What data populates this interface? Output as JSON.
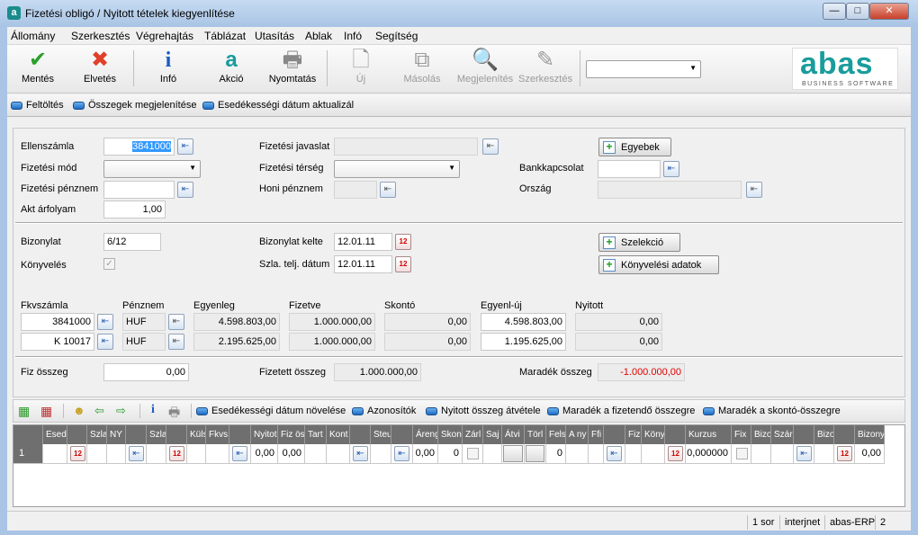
{
  "window": {
    "title": "Fizetési obligó / Nyitott tételek kiegyenlítése",
    "minimize": "—",
    "maximize": "□",
    "close": "✕"
  },
  "menu": [
    "Állomány",
    "Szerkesztés",
    "Végrehajtás",
    "Táblázat",
    "Utasítás",
    "Ablak",
    "Infó",
    "Segítség"
  ],
  "toolbar": {
    "save": "Mentés",
    "discard": "Elvetés",
    "info": "Infó",
    "action": "Akció",
    "print": "Nyomtatás",
    "new": "Új",
    "copy": "Másolás",
    "view": "Megjelenítés",
    "edit": "Szerkesztés",
    "combo_value": ""
  },
  "logo": {
    "text": "abas",
    "sub": "BUSINESS SOFTWARE",
    "color": "#1a9c9c"
  },
  "actions": [
    "Feltöltés",
    "Összegek megjelenítése",
    "Esedékességi dátum aktualizál"
  ],
  "form": {
    "ellenszamla_label": "Ellenszámla",
    "ellenszamla": "3841000",
    "fizmod_label": "Fizetési mód",
    "fizmod": "",
    "fizpenznem_label": "Fizetési pénznem",
    "fizpenznem": "",
    "arfolyam_label": "Akt árfolyam",
    "arfolyam": "1,00",
    "javaslat_label": "Fizetési javaslat",
    "javaslat": "",
    "terseg_label": "Fizetési térség",
    "terseg": "",
    "honi_label": "Honi pénznem",
    "honi": "",
    "egyebek": "Egyebek",
    "bank_label": "Bankkapcsolat",
    "bank": "",
    "orszag_label": "Ország",
    "orszag": "",
    "bizonylat_label": "Bizonylat",
    "bizonylat": "6/12",
    "konyveles_label": "Könyvelés",
    "konyveles_checked": true,
    "kelte_label": "Bizonylat kelte",
    "kelte": "12.01.11",
    "telj_label": "Szla. telj. dátum",
    "telj": "12.01.11",
    "szelekcio": "Szelekció",
    "konyv_adatok": "Könyvelési adatok",
    "acc_headers": [
      "Fkvszámla",
      "Pénznem",
      "Egyenleg",
      "Fizetve",
      "Skontó",
      "Egyenl-új",
      "Nyitott"
    ],
    "acc_rows": [
      [
        "3841000",
        "HUF",
        "4.598.803,00",
        "1.000.000,00",
        "0,00",
        "4.598.803,00",
        "0,00"
      ],
      [
        "K 10017",
        "HUF",
        "2.195.625,00",
        "1.000.000,00",
        "0,00",
        "1.195.625,00",
        "0,00"
      ]
    ],
    "fizosszeg_label": "Fiz összeg",
    "fizosszeg": "0,00",
    "fizetett_label": "Fizetett összeg",
    "fizetett": "1.000.000,00",
    "maradek_label": "Maradék összeg",
    "maradek": "-1.000.000,00",
    "maradek_color": "#e00000"
  },
  "grid_actions": [
    "Esedékességi dátum növelése",
    "Azonosítók",
    "Nyitott összeg átvétele",
    "Maradék a fizetendő összegre",
    "Maradék a skontó-összegre"
  ],
  "grid": {
    "columns": [
      {
        "h": "",
        "v": "1",
        "t": "rowhead"
      },
      {
        "h": "Esed",
        "v": ""
      },
      {
        "h": "",
        "t": "cal"
      },
      {
        "h": "Szla",
        "v": ""
      },
      {
        "h": "NY",
        "v": ""
      },
      {
        "h": "",
        "t": "lk"
      },
      {
        "h": "Szla",
        "v": ""
      },
      {
        "h": "",
        "t": "cal"
      },
      {
        "h": "Küls",
        "v": ""
      },
      {
        "h": "Fkvs",
        "v": ""
      },
      {
        "h": "",
        "t": "lk"
      },
      {
        "h": "Nyitot",
        "v": "0,00"
      },
      {
        "h": "Fiz ös",
        "v": "0,00"
      },
      {
        "h": "Tart",
        "v": ""
      },
      {
        "h": "Kont",
        "v": ""
      },
      {
        "h": "",
        "t": "lk"
      },
      {
        "h": "Steu",
        "v": ""
      },
      {
        "h": "",
        "t": "lk"
      },
      {
        "h": "Áreng",
        "v": "0,00"
      },
      {
        "h": "Skon",
        "v": "0"
      },
      {
        "h": "Zárl",
        "t": "chk"
      },
      {
        "h": "Saj",
        "v": ""
      },
      {
        "h": "Átvi",
        "t": "pb"
      },
      {
        "h": "Törl",
        "t": "pb"
      },
      {
        "h": "Fels",
        "v": "0"
      },
      {
        "h": "A ny",
        "v": ""
      },
      {
        "h": "Ffi",
        "v": ""
      },
      {
        "h": "",
        "t": "lk"
      },
      {
        "h": "Fizi",
        "v": ""
      },
      {
        "h": "Köny",
        "v": ""
      },
      {
        "h": "",
        "t": "cal"
      },
      {
        "h": "Kurzus",
        "v": "0,000000"
      },
      {
        "h": "Fix",
        "t": "chk"
      },
      {
        "h": "Bizo",
        "v": ""
      },
      {
        "h": "Szár",
        "v": ""
      },
      {
        "h": "",
        "t": "lk"
      },
      {
        "h": "Bizo",
        "v": ""
      },
      {
        "h": "",
        "t": "cal"
      },
      {
        "h": "Bizony",
        "v": "0,00"
      }
    ]
  },
  "status": {
    "rows": "1 sor",
    "conn": "interjnet",
    "app": "abas-ERP",
    "num": "2"
  }
}
